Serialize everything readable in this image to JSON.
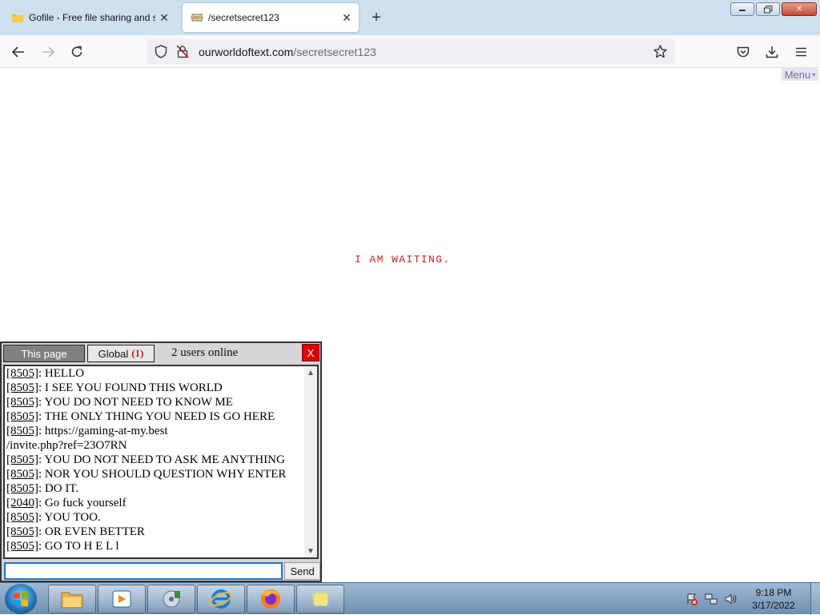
{
  "browser": {
    "tabs": [
      {
        "title": "Gofile - Free file sharing and sto",
        "icon": "folder-favicon",
        "active": false
      },
      {
        "title": "/secretsecret123",
        "icon": "scroll-favicon",
        "active": true
      }
    ],
    "new_tab": "+",
    "url": {
      "domain": "ourworldoftext.com",
      "path": "/secretsecret123"
    }
  },
  "page": {
    "menu_label": "Menu",
    "menu_caret": "▾",
    "world_text": "I AM WAITING."
  },
  "chat": {
    "tab_page": "This page",
    "tab_global": "Global",
    "global_count": "(1)",
    "users_online": "2 users online",
    "close_label": "X",
    "send_label": "Send",
    "input_value": "",
    "messages": [
      {
        "nick": "[8505]",
        "text": " HELLO"
      },
      {
        "nick": "[8505]",
        "text": " I SEE YOU FOUND THIS WORLD"
      },
      {
        "nick": "[8505]",
        "text": " YOU DO NOT NEED TO KNOW ME"
      },
      {
        "nick": "[8505]",
        "text": " THE ONLY THING YOU NEED IS GO HERE"
      },
      {
        "nick": "[8505]",
        "text": " https://gaming-at-my.best"
      },
      {
        "nick": "",
        "text": "/invite.php?ref=23O7RN"
      },
      {
        "nick": "[8505]",
        "text": " YOU DO NOT NEED TO ASK ME ANYTHING"
      },
      {
        "nick": "[8505]",
        "text": " NOR YOU SHOULD QUESTION WHY ENTER"
      },
      {
        "nick": "[8505]",
        "text": " DO IT."
      },
      {
        "nick": "[2040]",
        "text": " Go fuck yourself"
      },
      {
        "nick": "[8505]",
        "text": " YOU TOO."
      },
      {
        "nick": "[8505]",
        "text": " OR EVEN BETTER"
      },
      {
        "nick": "[8505]",
        "text": " GO TO H E L l"
      }
    ]
  },
  "taskbar": {
    "items": [
      "explorer-icon",
      "media-player-icon",
      "media-center-icon",
      "internet-explorer-icon",
      "firefox-icon",
      "sticky-notes-icon"
    ],
    "clock": {
      "time": "9:18 PM",
      "date": "3/17/2022"
    }
  }
}
